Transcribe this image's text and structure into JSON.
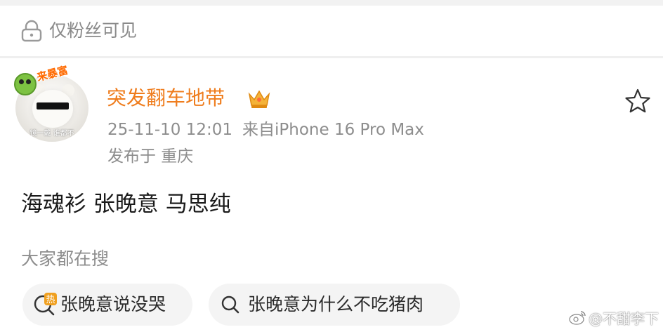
{
  "visibility": {
    "label": "仅粉丝可见",
    "icon": "lock-icon"
  },
  "post": {
    "author": {
      "name": "突发翻车地带",
      "badge_icon": "crown-icon",
      "avatar_sticker": "来暴富",
      "avatar_caption": "镜一戴 谁都不"
    },
    "timestamp": "25-11-10 12:01",
    "source": "来自iPhone 16 Pro Max",
    "location": "发布于 重庆",
    "text": "海魂衫 张晚意 马思纯",
    "favorite_icon": "star-icon"
  },
  "related_search": {
    "title": "大家都在搜",
    "items": [
      {
        "icon": "hot-search-icon",
        "icon_text": "热",
        "label": "张晚意说没哭"
      },
      {
        "icon": "search-icon",
        "label": "张晚意为什么不吃猪肉"
      }
    ]
  },
  "watermark": {
    "text": "@不甜李下",
    "icon": "weibo-logo-icon"
  },
  "colors": {
    "username": "#ef7d1e",
    "meta_text": "#8d8d8d",
    "chip_background": "#f4f4f4",
    "hot_icon": "#f0a020"
  }
}
